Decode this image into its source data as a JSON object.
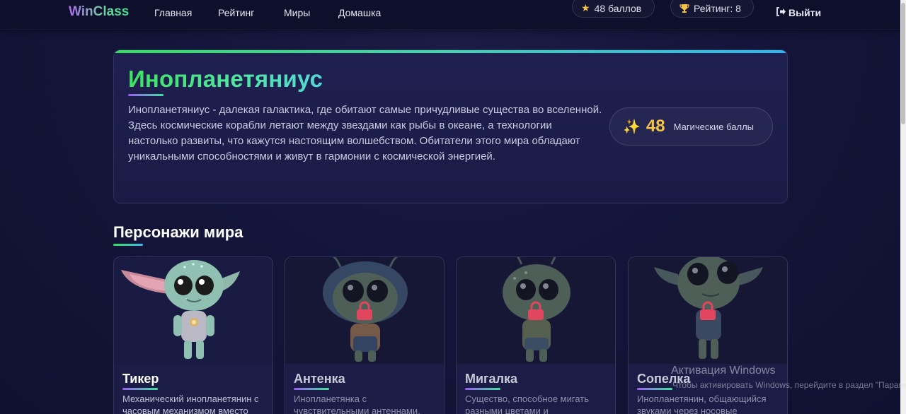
{
  "nav": {
    "brand": "WinClass",
    "links": [
      "Главная",
      "Рейтинг",
      "Миры",
      "Домашка"
    ],
    "points_badge": "48 баллов",
    "rating_badge": "Рейтинг: 8",
    "logout": "Выйти"
  },
  "hero": {
    "title": "Инопланетяниус",
    "description": "Инопланетяниус - далекая галактика, где обитают самые причудливые существа во вселенной. Здесь космические корабли летают между звездами как рыбы в океане, а технологии настолько развиты, что кажутся настоящим волшебством. Обитатели этого мира обладают уникальными способностями и живут в гармонии с космической энергией.",
    "points_value": "48",
    "points_label": "Магические баллы",
    "accent_colors": [
      "#2fe35a",
      "#2bb8f0"
    ]
  },
  "characters_section": {
    "title": "Персонажи мира",
    "cards": [
      {
        "name": "Тикер",
        "description": "Механический инопланетянин с часовым механизмом вместо",
        "locked": false
      },
      {
        "name": "Антенка",
        "description": "Инопланетянка с чувствительными антеннами,",
        "locked": true
      },
      {
        "name": "Мигалка",
        "description": "Существо, способное мигать разными цветами и",
        "locked": true
      },
      {
        "name": "Сопелка",
        "description": "Инопланетянин, общающийся звуками через носовые",
        "locked": true
      }
    ]
  },
  "watermark": {
    "title": "Активация Windows",
    "subtitle": "Чтобы активировать Windows, перейдите в раздел \"Параметры\"."
  }
}
